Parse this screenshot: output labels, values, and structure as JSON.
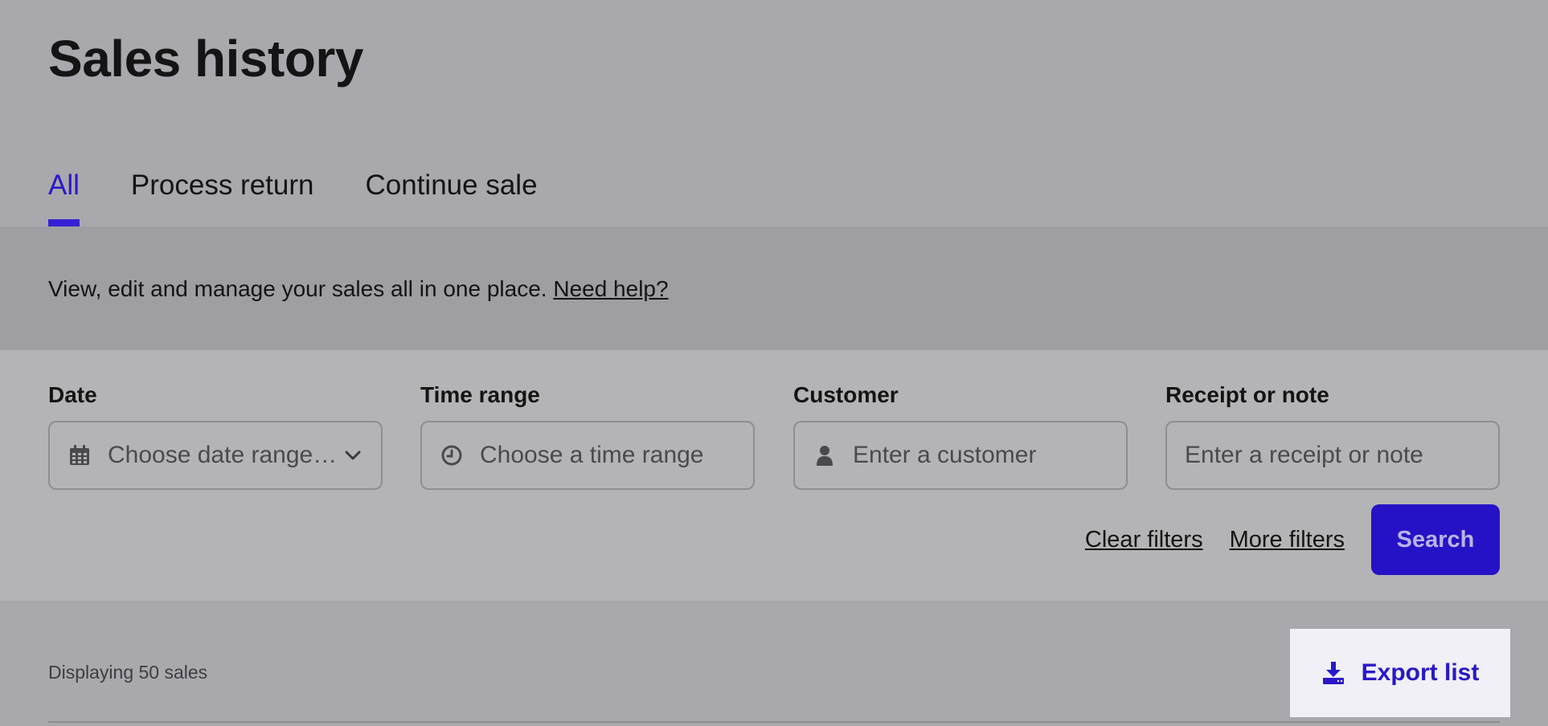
{
  "page": {
    "title": "Sales history"
  },
  "tabs": [
    {
      "label": "All",
      "active": true
    },
    {
      "label": "Process return",
      "active": false
    },
    {
      "label": "Continue sale",
      "active": false
    }
  ],
  "info": {
    "text": "View, edit and manage your sales all in one place.",
    "help_link": "Need help?"
  },
  "filters": {
    "date": {
      "label": "Date",
      "placeholder": "Choose date range…",
      "icon": "calendar-icon"
    },
    "time_range": {
      "label": "Time range",
      "placeholder": "Choose a time range",
      "icon": "clock-icon"
    },
    "customer": {
      "label": "Customer",
      "placeholder": "Enter a customer",
      "icon": "user-icon"
    },
    "receipt": {
      "label": "Receipt or note",
      "placeholder": "Enter a receipt or note"
    }
  },
  "actions": {
    "clear": "Clear filters",
    "more": "More filters",
    "search": "Search"
  },
  "results": {
    "count_text": "Displaying 50 sales",
    "export_label": "Export list",
    "export_icon": "download-icon"
  },
  "colors": {
    "accent": "#2612c6",
    "background": "#a9a8ad",
    "panel": "#b4b4b6"
  }
}
